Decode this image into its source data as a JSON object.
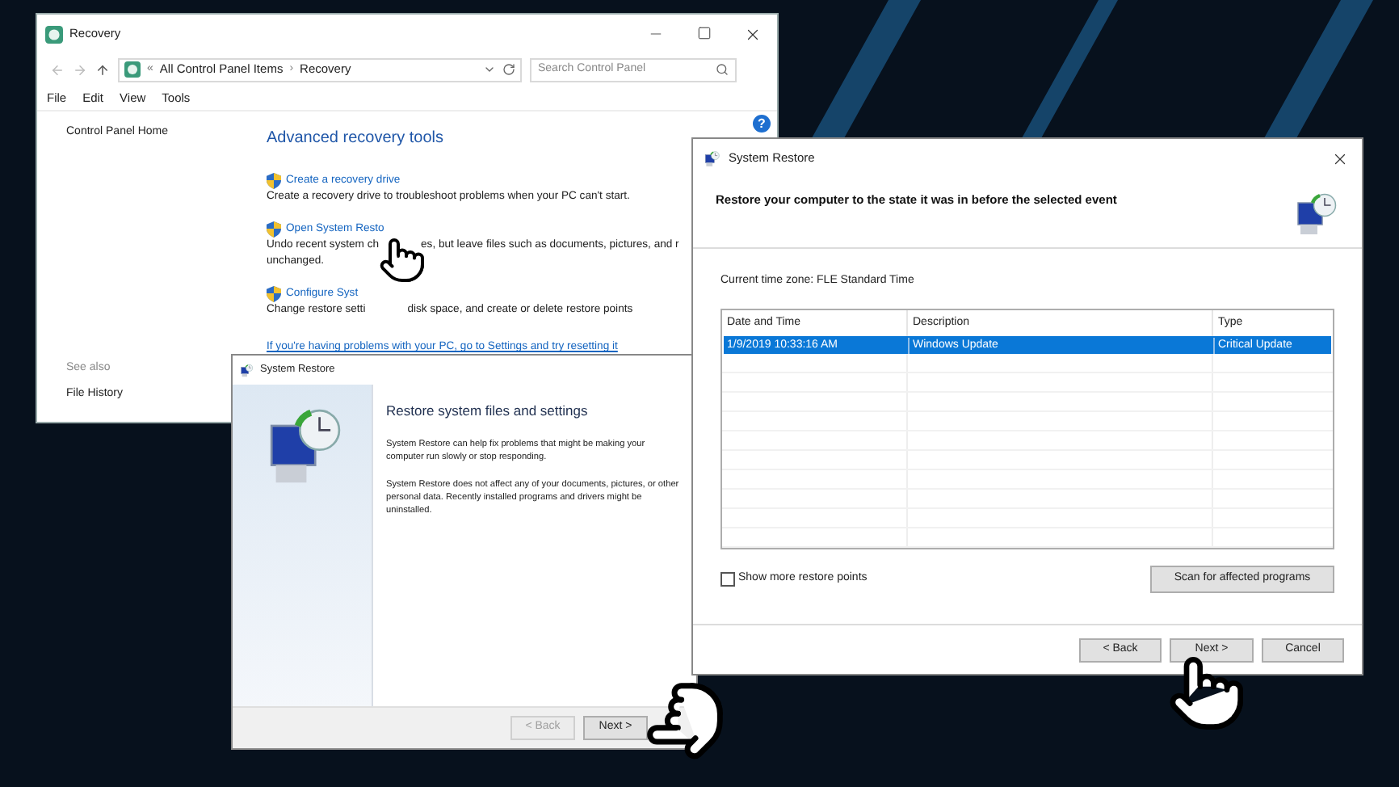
{
  "control_panel": {
    "title": "Recovery",
    "overflow_marker": "«",
    "separator": "›",
    "help": "?",
    "breadcrumb": [
      "All Control Panel Items",
      "Recovery"
    ],
    "search": {
      "placeholder": "Search Control Panel"
    },
    "menu": [
      "File",
      "Edit",
      "View",
      "Tools"
    ],
    "sidebar": {
      "home": "Control Panel Home",
      "see_also": "See also",
      "links": [
        "File History"
      ]
    },
    "heading": "Advanced recovery tools",
    "tools": [
      {
        "link": "Create a recovery drive",
        "lines": [
          [
            "Create a recovery drive to troubleshoot problems when your PC can't start."
          ]
        ]
      },
      {
        "link": "Open System Resto",
        "lines": [
          [
            "Undo recent system ch",
            "es, but leave files such as documents, pictures, and r"
          ],
          [
            "unchanged."
          ]
        ]
      },
      {
        "link": "Configure Syst",
        "lines": [
          [
            "Change restore setti",
            "disk space, and create or delete restore points"
          ]
        ]
      }
    ],
    "reset_link": "If you're having problems with your PC, go to Settings and try resetting it"
  },
  "wizard": {
    "title": "System Restore",
    "heading": "Restore system files and settings",
    "paragraphs": [
      "System Restore can help fix problems that might be making your computer run slowly or stop responding.",
      "System Restore does not affect any of your documents, pictures, or other personal data. Recently installed programs and drivers might be uninstalled."
    ],
    "buttons": [
      {
        "label": "< Back",
        "disabled": true
      },
      {
        "label": "Next >",
        "disabled": false
      }
    ]
  },
  "restore_points": {
    "title": "System Restore",
    "heading": "Restore your computer to the state it was in before the selected event",
    "time_zone": "Current time zone: FLE Standard Time",
    "table": {
      "columns": [
        "Date and Time",
        "Description",
        "Type"
      ],
      "rows": [
        {
          "cells": [
            "1/9/2019 10:33:16 AM",
            "Windows Update",
            "Critical Update"
          ],
          "selected": true
        }
      ]
    },
    "checkbox": {
      "label": "Show more restore points",
      "checked": false
    },
    "scan_button": "Scan for affected programs",
    "buttons": [
      {
        "label": "< Back",
        "disabled": false
      },
      {
        "label": "Next >",
        "disabled": false
      },
      {
        "label": "Cancel",
        "disabled": false
      }
    ]
  }
}
